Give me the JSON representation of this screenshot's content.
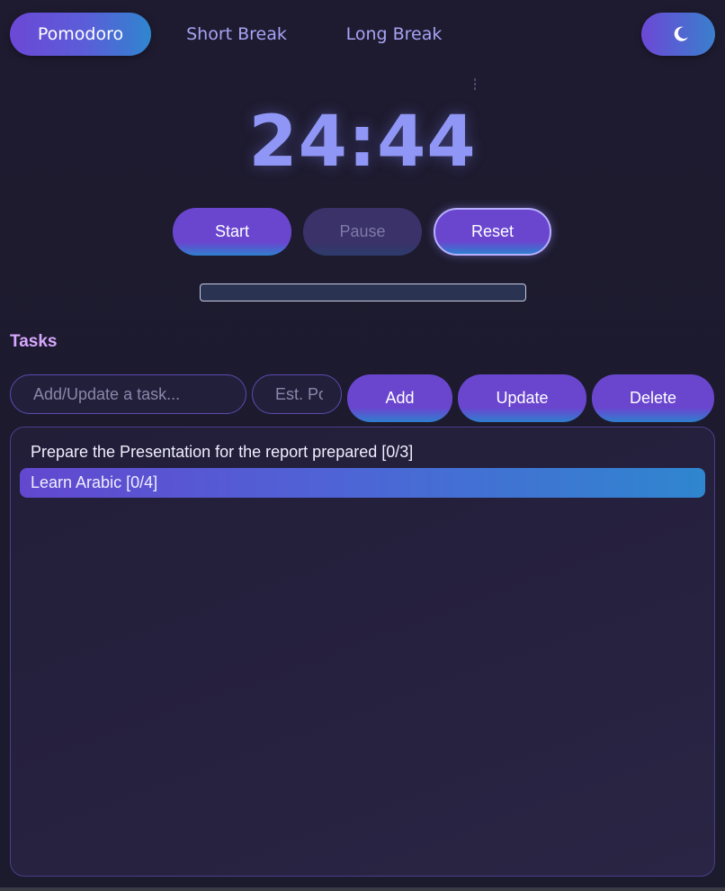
{
  "modes": {
    "pomodoro": "Pomodoro",
    "short_break": "Short Break",
    "long_break": "Long Break",
    "active": "pomodoro"
  },
  "theme_toggle": {
    "icon": "moon-icon"
  },
  "timer": {
    "display": "24:44"
  },
  "controls": {
    "start": "Start",
    "pause": "Pause",
    "reset": "Reset"
  },
  "progress": {
    "fraction": 0.0
  },
  "tasks": {
    "heading": "Tasks",
    "input_placeholder": "Add/Update a task...",
    "estimate_placeholder": "Est. Pomodoros",
    "add_label": "Add",
    "update_label": "Update",
    "delete_label": "Delete",
    "items": [
      {
        "label": "Prepare the Presentation for the report prepared [0/3]",
        "selected": false
      },
      {
        "label": "Learn Arabic [0/4]",
        "selected": true
      }
    ]
  },
  "colors": {
    "accent_purple": "#6a46cf",
    "accent_blue": "#2f86cf",
    "timer_text": "#8f96f5",
    "tasks_heading": "#d7a8ff",
    "background": "#1c1a2e"
  }
}
